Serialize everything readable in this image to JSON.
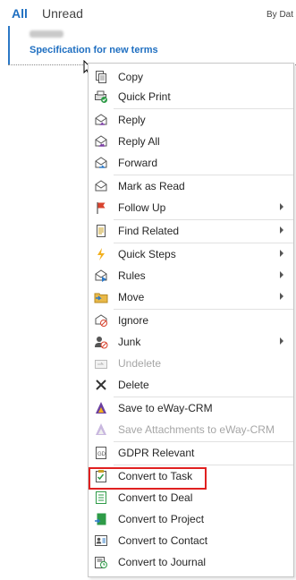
{
  "tabs": {
    "all": "All",
    "unread": "Unread",
    "sort": "By Dat"
  },
  "message": {
    "subject": "Specification for new terms"
  },
  "menu": {
    "items": [
      {
        "label": "Copy",
        "icon": "copy-icon"
      },
      {
        "label": "Quick Print",
        "icon": "quick-print-icon"
      },
      {
        "label": "Reply",
        "icon": "reply-icon"
      },
      {
        "label": "Reply All",
        "icon": "reply-all-icon"
      },
      {
        "label": "Forward",
        "icon": "forward-icon"
      },
      {
        "label": "Mark as Read",
        "icon": "mark-as-read-icon"
      },
      {
        "label": "Follow Up",
        "icon": "flag-icon",
        "submenu": true
      },
      {
        "label": "Find Related",
        "icon": "find-related-icon",
        "submenu": true
      },
      {
        "label": "Quick Steps",
        "icon": "lightning-icon",
        "submenu": true
      },
      {
        "label": "Rules",
        "icon": "rules-icon",
        "submenu": true
      },
      {
        "label": "Move",
        "icon": "folder-icon",
        "submenu": true
      },
      {
        "label": "Ignore",
        "icon": "ignore-icon"
      },
      {
        "label": "Junk",
        "icon": "junk-icon",
        "submenu": true
      },
      {
        "label": "Undelete",
        "icon": "undelete-icon",
        "disabled": true
      },
      {
        "label": "Delete",
        "icon": "delete-icon"
      },
      {
        "label": "Save to eWay-CRM",
        "icon": "eway-save-icon"
      },
      {
        "label": "Save Attachments to eWay-CRM",
        "icon": "eway-attachments-icon",
        "disabled": true
      },
      {
        "label": "GDPR Relevant",
        "icon": "gdpr-icon"
      },
      {
        "label": "Convert to Task",
        "icon": "task-icon",
        "highlighted": true
      },
      {
        "label": "Convert to Deal",
        "icon": "deal-icon"
      },
      {
        "label": "Convert to Project",
        "icon": "project-icon"
      },
      {
        "label": "Convert to Contact",
        "icon": "contact-icon"
      },
      {
        "label": "Convert to Journal",
        "icon": "journal-icon"
      }
    ]
  },
  "colors": {
    "accent": "#1f6fc1",
    "highlight_border": "#e02020",
    "disabled_text": "#a6a6a6"
  }
}
